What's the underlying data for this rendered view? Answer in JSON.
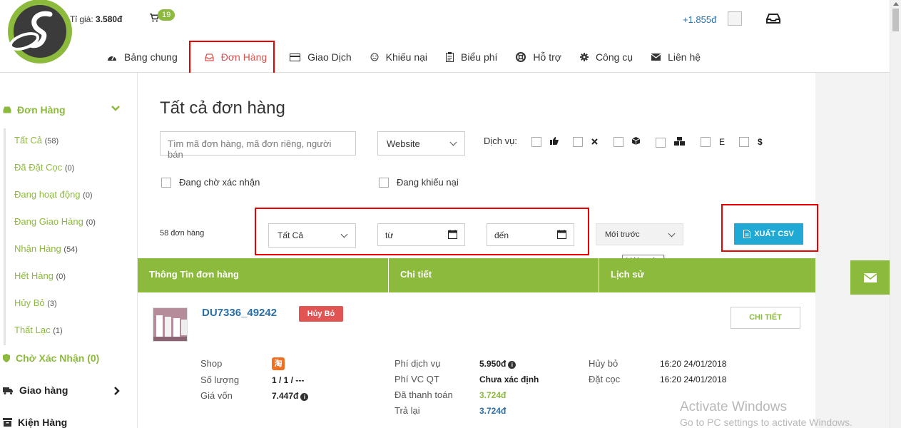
{
  "header": {
    "rate_label": "Tỉ giá:",
    "rate_value": "3.580đ",
    "cart_count": "19",
    "balance": "+1.855đ"
  },
  "nav": [
    {
      "label": "Bảng chung",
      "icon": "dashboard-icon"
    },
    {
      "label": "Đơn Hàng",
      "icon": "inbox-icon",
      "active": true
    },
    {
      "label": "Giao Dịch",
      "icon": "credit-card-icon"
    },
    {
      "label": "Khiếu nại",
      "icon": "frown-icon"
    },
    {
      "label": "Biểu phí",
      "icon": "clipboard-icon"
    },
    {
      "label": "Hỗ trợ",
      "icon": "lifebuoy-icon"
    },
    {
      "label": "Công cụ",
      "icon": "gear-icon"
    },
    {
      "label": "Liên hệ",
      "icon": "envelope-icon"
    }
  ],
  "sidebar": {
    "head": "Đơn Hàng",
    "items": [
      {
        "label": "Tất Cả",
        "count": "(58)"
      },
      {
        "label": "Đã Đặt Cọc",
        "count": "(0)"
      },
      {
        "label": "Đang hoạt động",
        "count": "(0)"
      },
      {
        "label": "Đang Giao Hàng",
        "count": "(0)"
      },
      {
        "label": "Nhận Hàng",
        "count": "(54)"
      },
      {
        "label": "Hết Hàng",
        "count": "(0)"
      },
      {
        "label": "Hủy Bỏ",
        "count": "(3)"
      },
      {
        "label": "Thất Lạc",
        "count": "(1)"
      }
    ],
    "pending": "Chờ Xác Nhận (0)",
    "delivery": "Giao hàng",
    "warehouse": "Kiện Hàng"
  },
  "main": {
    "title": "Tất cả đơn hàng",
    "search_placeholder": "Tìm mã đơn hàng, mã đơn riêng, người bán",
    "website_select": "Website",
    "service_label": "Dịch vụ:",
    "services": [
      "thumbs-up-icon",
      "close-icon",
      "box-icon",
      "cubes-icon",
      "E",
      "$"
    ],
    "check_pending": "Đang chờ xác nhận",
    "check_complaint": "Đang khiếu nại",
    "order_count": "58 đơn hàng",
    "status_select": "Tất Cả",
    "date_from": "từ",
    "date_to": "đến",
    "sort_select": "Mới trước",
    "tooltip": "Mới trước",
    "export_btn": "XUẤT CSV"
  },
  "table": {
    "headers": [
      "Thông Tin đơn hàng",
      "Chi tiết",
      "Lịch sử"
    ]
  },
  "order": {
    "id": "DU7336_49242",
    "status": "Hủy Bỏ",
    "detail_btn": "CHI TIẾT",
    "shop_label": "Shop",
    "shop_icon": "淘",
    "qty_label": "Số lượng",
    "qty_value": "1 / 1 / ---",
    "cost_label": "Giá vốn",
    "cost_value": "7.447đ",
    "fees": [
      {
        "label": "Phí dịch vụ",
        "value": "5.950đ",
        "style": "bold",
        "info": true
      },
      {
        "label": "Phí VC QT",
        "value": "Chưa xác định",
        "style": "bold"
      },
      {
        "label": "Đã thanh toán",
        "value": "3.724đ",
        "style": "green"
      },
      {
        "label": "Trả lại",
        "value": "3.724đ",
        "style": "blue"
      }
    ],
    "history": [
      {
        "label": "Hủy bỏ",
        "value": "16:20 24/01/2018"
      },
      {
        "label": "Đặt cọc",
        "value": "16:20 24/01/2018"
      }
    ]
  },
  "watermark": {
    "line1": "Activate Windows",
    "line2": "Go to PC settings to activate Windows."
  },
  "colors": {
    "accent": "#8cba3c",
    "link": "#2a6fa8",
    "danger": "#e05454",
    "export": "#1fa9d4"
  }
}
